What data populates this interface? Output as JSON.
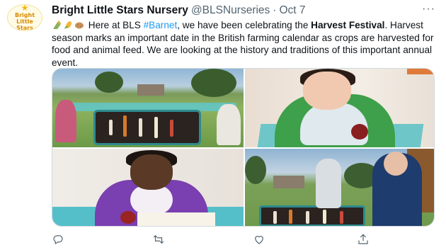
{
  "tweet": {
    "display_name": "Bright Little Stars Nursery",
    "handle": "@BLSNurseries",
    "separator": "·",
    "date": "Oct 7",
    "avatar_text_line1": "Bright",
    "avatar_text_line2": "Little Stars",
    "body": {
      "part1": "Here at BLS ",
      "hashtag": "#Barnet",
      "part2": ", we have been celebrating the ",
      "bold1": "Harvest Festival",
      "part3": ". Harvest season marks an important date in the British farming calendar as crops are harvested for food and animal feed. We are looking at the history and traditions of this important annual event."
    },
    "emoji_icons": [
      "sheaf-of-rice-icon",
      "corn-icon",
      "potato-icon"
    ],
    "media": [
      {
        "name": "photo-outdoor-harvest-table"
      },
      {
        "name": "photo-toddler-green-top"
      },
      {
        "name": "photo-child-purple-top"
      },
      {
        "name": "photo-children-garden"
      }
    ],
    "actions": {
      "reply": {
        "icon": "reply-icon",
        "count": ""
      },
      "retweet": {
        "icon": "retweet-icon",
        "count": ""
      },
      "like": {
        "icon": "heart-icon",
        "count": ""
      },
      "share": {
        "icon": "share-icon",
        "count": ""
      }
    }
  }
}
